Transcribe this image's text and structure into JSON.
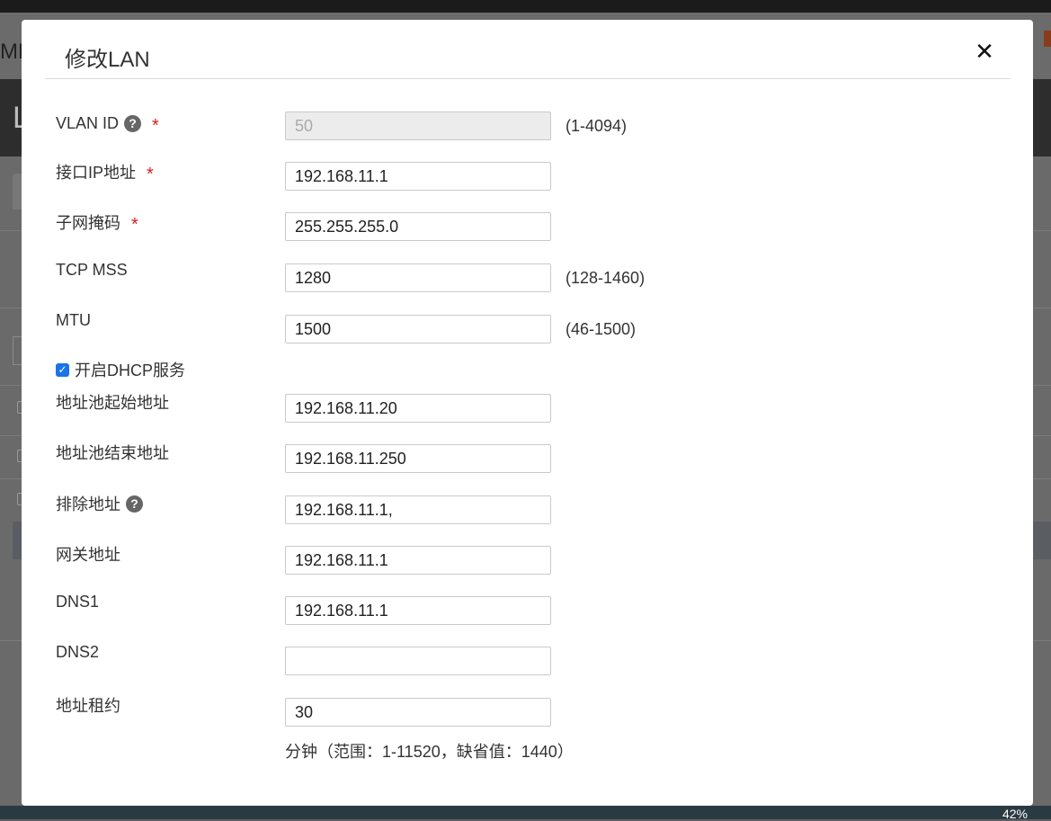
{
  "background": {
    "header_partial_text": "ME",
    "nav_partial_letter": "L",
    "taskbar_percent": "42%"
  },
  "modal": {
    "title": "修改LAN",
    "close_label": "✕"
  },
  "fields": {
    "vlan_id": {
      "label": "VLAN ID",
      "value": "50",
      "range": "(1-4094)",
      "required": "*"
    },
    "interface_ip": {
      "label": "接口IP地址",
      "value": "192.168.11.1",
      "required": "*"
    },
    "subnet_mask": {
      "label": "子网掩码",
      "value": "255.255.255.0",
      "required": "*"
    },
    "tcp_mss": {
      "label": "TCP MSS",
      "value": "1280",
      "range": "(128-1460)"
    },
    "mtu": {
      "label": "MTU",
      "value": "1500",
      "range": "(46-1500)"
    },
    "dhcp": {
      "label": "开启DHCP服务",
      "checked": true
    },
    "pool_start": {
      "label": "地址池起始地址",
      "value": "192.168.11.20"
    },
    "pool_end": {
      "label": "地址池结束地址",
      "value": "192.168.11.250"
    },
    "exclude": {
      "label": "排除地址",
      "value": "192.168.11.1,"
    },
    "gateway": {
      "label": "网关地址",
      "value": "192.168.11.1"
    },
    "dns1": {
      "label": "DNS1",
      "value": "192.168.11.1"
    },
    "dns2": {
      "label": "DNS2",
      "value": ""
    },
    "lease": {
      "label": "地址租约",
      "value": "30",
      "note": "分钟（范围：1-11520，缺省值：1440）"
    }
  },
  "icons": {
    "help": "?",
    "check": "✓"
  },
  "colors": {
    "required": "#d9201a",
    "checkbox": "#1a73e8"
  }
}
